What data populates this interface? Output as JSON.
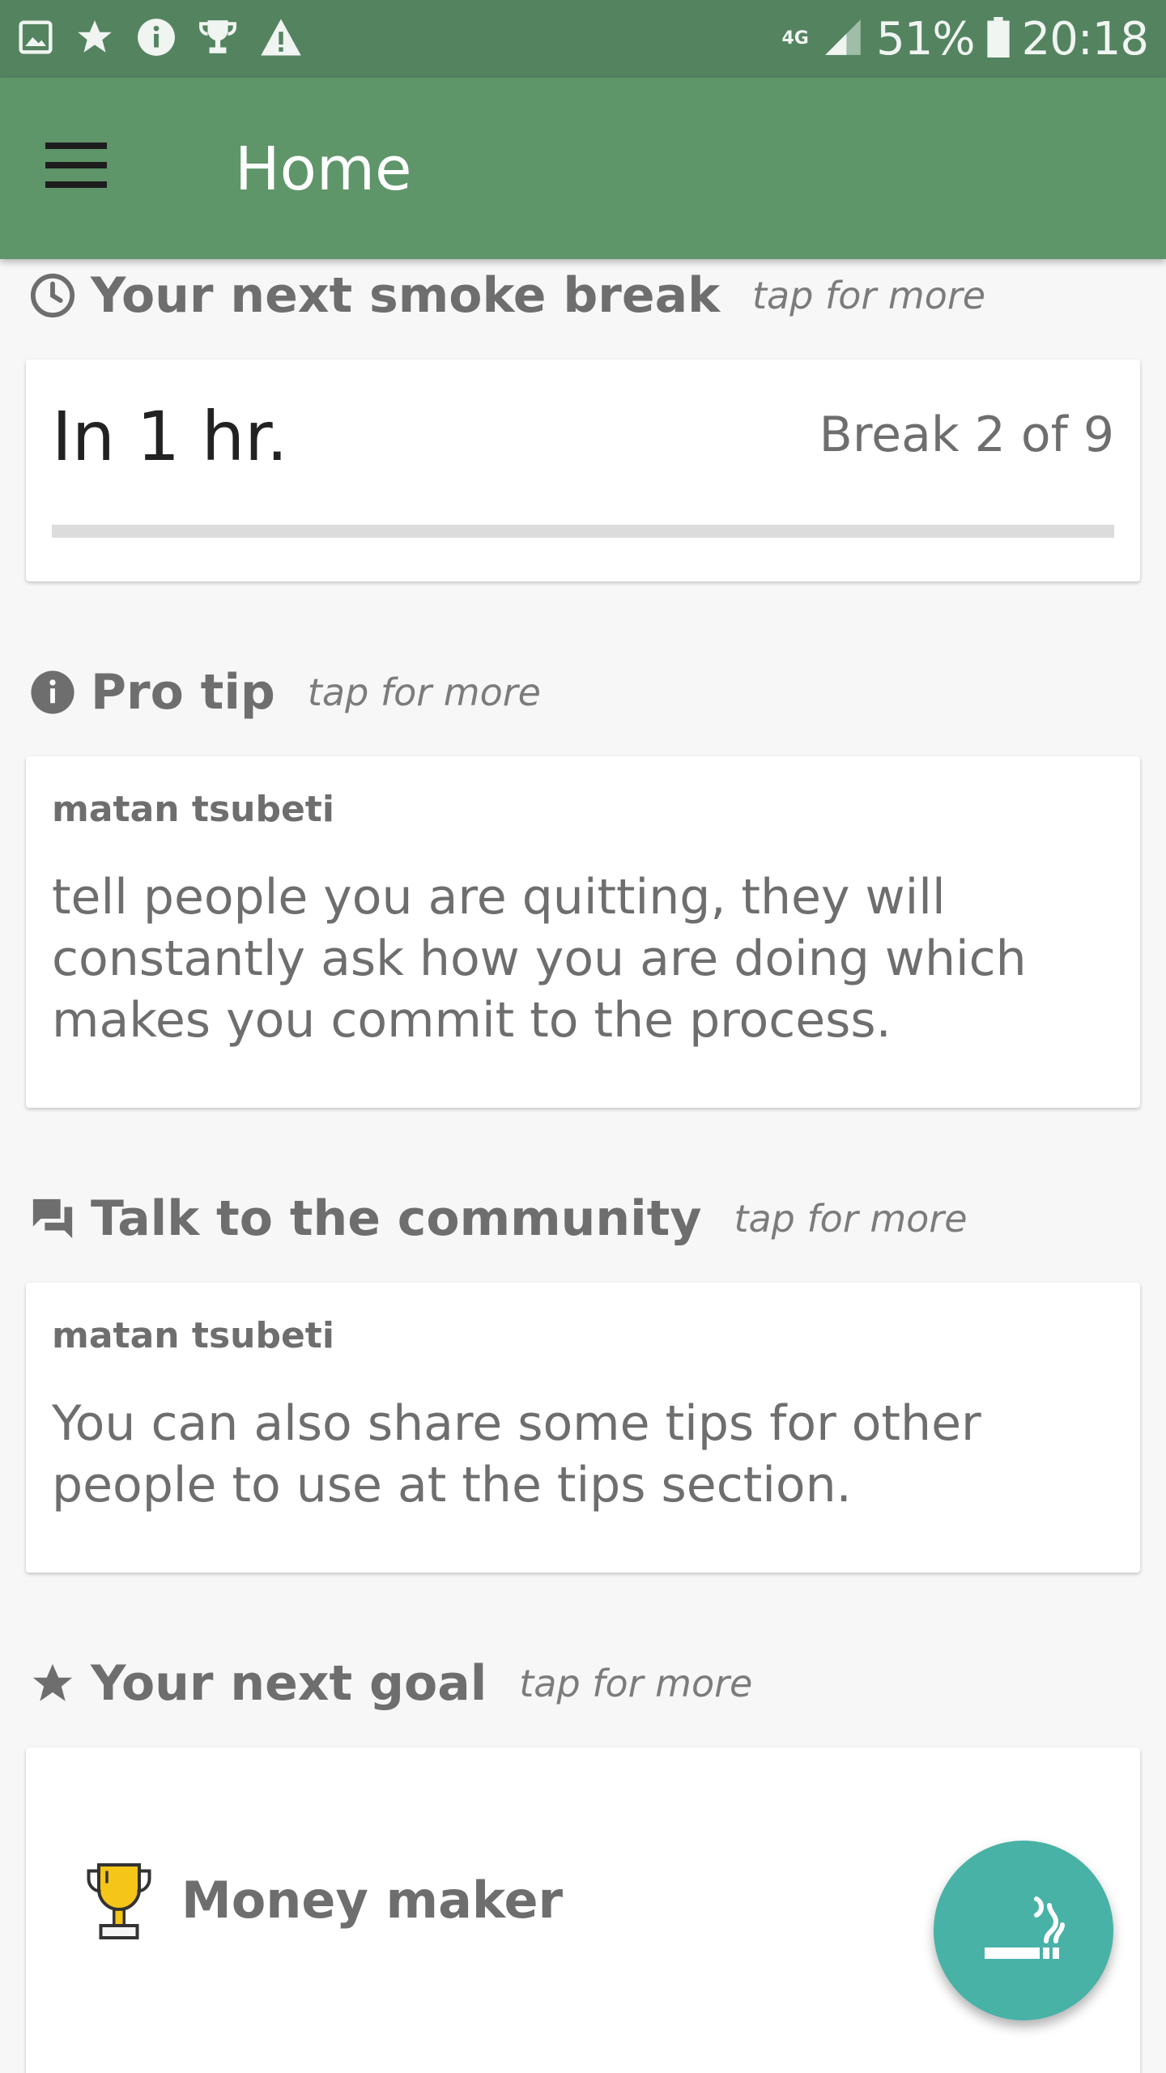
{
  "status_bar": {
    "network": "4G",
    "battery": "51%",
    "time": "20:18",
    "icons": [
      "image-icon",
      "star-icon",
      "info-icon",
      "trophy-icon",
      "warning-icon"
    ]
  },
  "app_bar": {
    "title": "Home"
  },
  "smoke_break": {
    "heading": "Your next smoke break",
    "more": "tap for more",
    "time_text": "In 1 hr.",
    "break_text": "Break 2 of 9",
    "progress": 0
  },
  "pro_tip": {
    "heading": "Pro tip",
    "more": "tap for more",
    "author": "matan tsubeti",
    "text": "tell people you are quitting, they will constantly ask how you are doing which makes you commit to the process."
  },
  "community": {
    "heading": "Talk to the community",
    "more": "tap for more",
    "author": "matan tsubeti",
    "text": "You can also share some tips for other people to use at the tips section."
  },
  "next_goal": {
    "heading": "Your next goal",
    "more": "tap for more",
    "goal_name": "Money maker"
  },
  "colors": {
    "status_bar": "#548360",
    "app_bar": "#5e9569",
    "fab": "#48b2a7",
    "trophy": "#f5c518"
  }
}
